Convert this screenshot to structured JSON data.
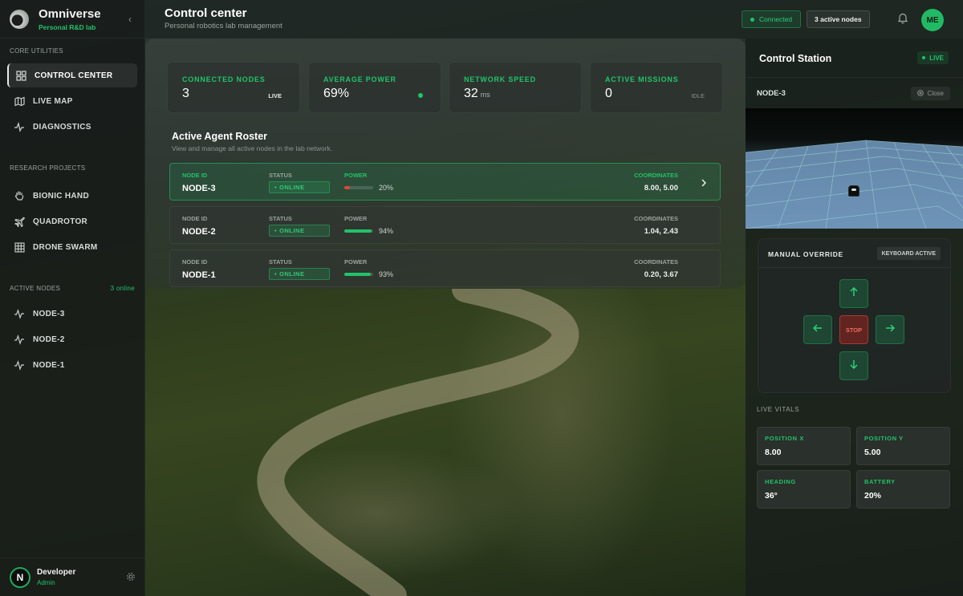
{
  "brand": {
    "name": "Omniverse",
    "subtitle": "Personal R&D lab"
  },
  "sidebar": {
    "core_title": "CORE UTILITIES",
    "core_items": [
      {
        "label": "CONTROL CENTER",
        "icon": "grid-icon",
        "active": true
      },
      {
        "label": "LIVE MAP",
        "icon": "map-icon"
      },
      {
        "label": "DIAGNOSTICS",
        "icon": "pulse-icon"
      }
    ],
    "research_title": "RESEARCH PROJECTS",
    "research_items": [
      {
        "label": "BIONIC HAND",
        "icon": "hand-icon"
      },
      {
        "label": "QUADROTOR",
        "icon": "plane-icon"
      },
      {
        "label": "DRONE SWARM",
        "icon": "grid-small-icon"
      }
    ],
    "nodes_title": "ACTIVE NODES",
    "nodes_online": "3 online",
    "node_items": [
      {
        "label": "NODE-3",
        "icon": "activity-icon"
      },
      {
        "label": "NODE-2",
        "icon": "activity-icon"
      },
      {
        "label": "NODE-1",
        "icon": "activity-icon"
      }
    ]
  },
  "user": {
    "initial": "N",
    "name": "Developer",
    "role": "Admin"
  },
  "header": {
    "title": "Control center",
    "subtitle": "Personal robotics lab management",
    "connection": "Connected",
    "active_nodes": "3 active nodes",
    "avatar": "ME"
  },
  "stats": [
    {
      "label": "CONNECTED NODES",
      "value": "3",
      "unit": "",
      "tag": "LIVE"
    },
    {
      "label": "AVERAGE POWER",
      "value": "69%",
      "unit": "",
      "tag": ""
    },
    {
      "label": "NETWORK SPEED",
      "value": "32",
      "unit": "ms",
      "tag": ""
    },
    {
      "label": "ACTIVE MISSIONS",
      "value": "0",
      "unit": "",
      "tag": "IDLE"
    }
  ],
  "roster": {
    "title": "Active Agent Roster",
    "subtitle": "View and manage all active nodes in the lab network.",
    "col_node": "NODE ID",
    "col_status": "STATUS",
    "col_power": "POWER",
    "col_coords": "COORDINATES",
    "rows": [
      {
        "id": "NODE-3",
        "status": "ONLINE",
        "power": 20,
        "power_label": "20%",
        "coords": "8.00, 5.00",
        "selected": true,
        "bar_color": "#e0453b"
      },
      {
        "id": "NODE-2",
        "status": "ONLINE",
        "power": 94,
        "power_label": "94%",
        "coords": "1.04, 2.43",
        "selected": false,
        "bar_color": "#22c26a"
      },
      {
        "id": "NODE-1",
        "status": "ONLINE",
        "power": 93,
        "power_label": "93%",
        "coords": "0.20, 3.67",
        "selected": false,
        "bar_color": "#22c26a"
      }
    ]
  },
  "station": {
    "title": "Control Station",
    "live": "LIVE",
    "node": "NODE-3",
    "close": "Close",
    "override_title": "MANUAL OVERRIDE",
    "keyboard": "KEYBOARD ACTIVE",
    "stop": "STOP",
    "vitals_title": "LIVE VITALS",
    "vitals": [
      {
        "label": "POSITION X",
        "value": "8.00"
      },
      {
        "label": "POSITION Y",
        "value": "5.00"
      },
      {
        "label": "HEADING",
        "value": "36°"
      },
      {
        "label": "BATTERY",
        "value": "20%"
      }
    ]
  },
  "colors": {
    "accent": "#22c26a",
    "danger": "#e0453b"
  }
}
